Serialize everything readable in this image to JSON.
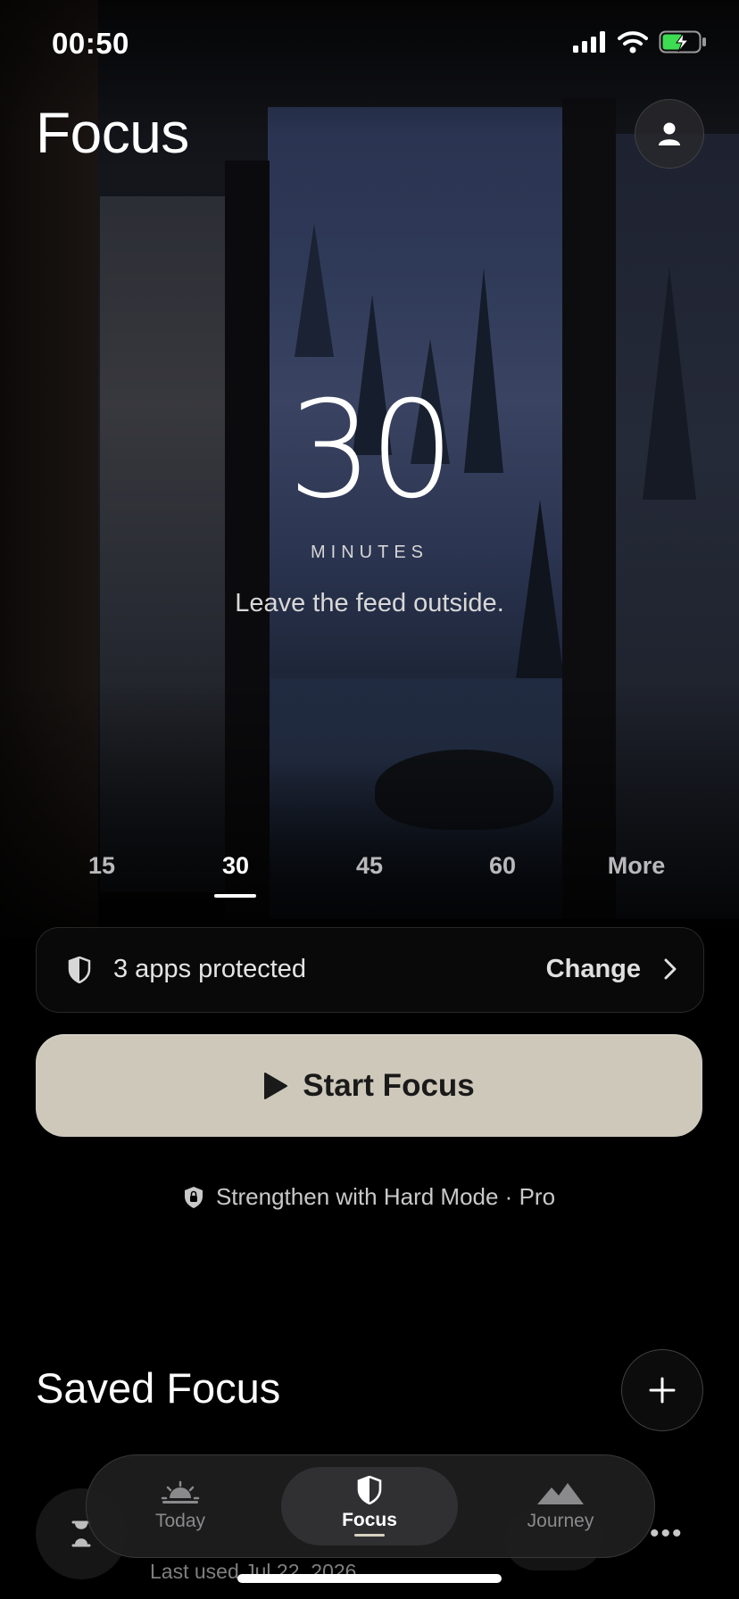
{
  "status_bar": {
    "time": "00:50"
  },
  "header": {
    "title": "Focus"
  },
  "timer": {
    "value": "30",
    "unit": "MINUTES",
    "tagline": "Leave the feed outside."
  },
  "durations": {
    "options": [
      "15",
      "30",
      "45",
      "60",
      "More"
    ],
    "selected": "30"
  },
  "apps": {
    "label": "3 apps protected",
    "action": "Change"
  },
  "start": {
    "label": "Start Focus"
  },
  "hard_mode": {
    "label": "Strengthen with Hard Mode · Pro"
  },
  "saved": {
    "title": "Saved Focus",
    "items": [
      {
        "last_used": "Last used Jul 22, 2026"
      }
    ]
  },
  "tabs": [
    {
      "label": "Today",
      "icon": "sunrise-icon"
    },
    {
      "label": "Focus",
      "icon": "shield-icon",
      "active": true
    },
    {
      "label": "Journey",
      "icon": "mountain-icon"
    }
  ],
  "colors": {
    "start_button_bg": "#cdc8ba",
    "background": "#000000"
  }
}
